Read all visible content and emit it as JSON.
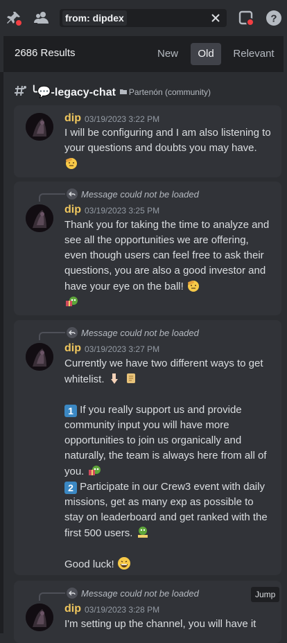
{
  "search": {
    "query": "from: dipdex"
  },
  "results": {
    "count_label": "2686 Results",
    "sort_options": [
      "New",
      "Old",
      "Relevant"
    ],
    "active_sort": "Old"
  },
  "channel": {
    "name": "╰💬-legacy-chat",
    "category": "Partenón (community)"
  },
  "messages": [
    {
      "reply": "",
      "username": "dip",
      "timestamp": "03/19/2023 3:22 PM",
      "text": "I will be configuring and I am also listening to your questions and doubts you may have."
    },
    {
      "reply": "Message could not be loaded",
      "username": "dip",
      "timestamp": "03/19/2023 3:25 PM",
      "text": "Thank you for taking the time to analyze and see all the opportunities we are offering, even though users can feel free to ask their questions, you are also a good investor and have your eye on the ball!"
    },
    {
      "reply": "Message could not be loaded",
      "username": "dip",
      "timestamp": "03/19/2023 3:27 PM",
      "line1": "Currently we have two different ways to get whitelist.",
      "num1": "1",
      "line2": "If you really support us and provide community input you will have more opportunities to join us organically and naturally, the team is always here from all of you.",
      "num2": "2",
      "line3": "Participate in our Crew3 event with daily missions, get as many exp as possible to stay on leaderboard and get ranked with the first 500 users.",
      "line4": "Good luck!"
    },
    {
      "reply": "Message could not be loaded",
      "username": "dip",
      "timestamp": "03/19/2023 3:28 PM",
      "text": "I'm setting up the channel, you will have it"
    }
  ],
  "jump_label": "Jump",
  "colors": {
    "background": "#2b2d31",
    "card": "#313338",
    "username": "#f0c75e",
    "accent": "#404249"
  },
  "icons": [
    "pin-icon",
    "members-icon",
    "clear-icon",
    "inbox-icon",
    "help-icon",
    "reply-arrow-icon",
    "folder-icon",
    "thread-hash-icon"
  ]
}
